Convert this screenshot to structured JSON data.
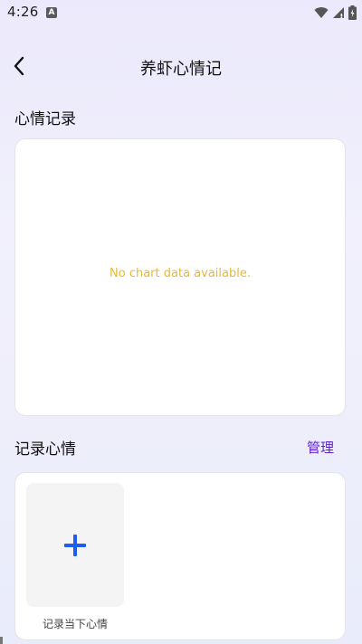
{
  "status_bar": {
    "time": "4:26",
    "app_badge": "A"
  },
  "header": {
    "title": "养虾心情记"
  },
  "mood_chart_section": {
    "title": "心情记录",
    "empty_message": "No chart data available."
  },
  "record_section": {
    "title": "记录心情",
    "manage_label": "管理",
    "add_label": "记录当下心情"
  },
  "colors": {
    "accent": "#5a1fd1",
    "plus": "#1f5cf0",
    "empty_text": "#e9b73a"
  }
}
